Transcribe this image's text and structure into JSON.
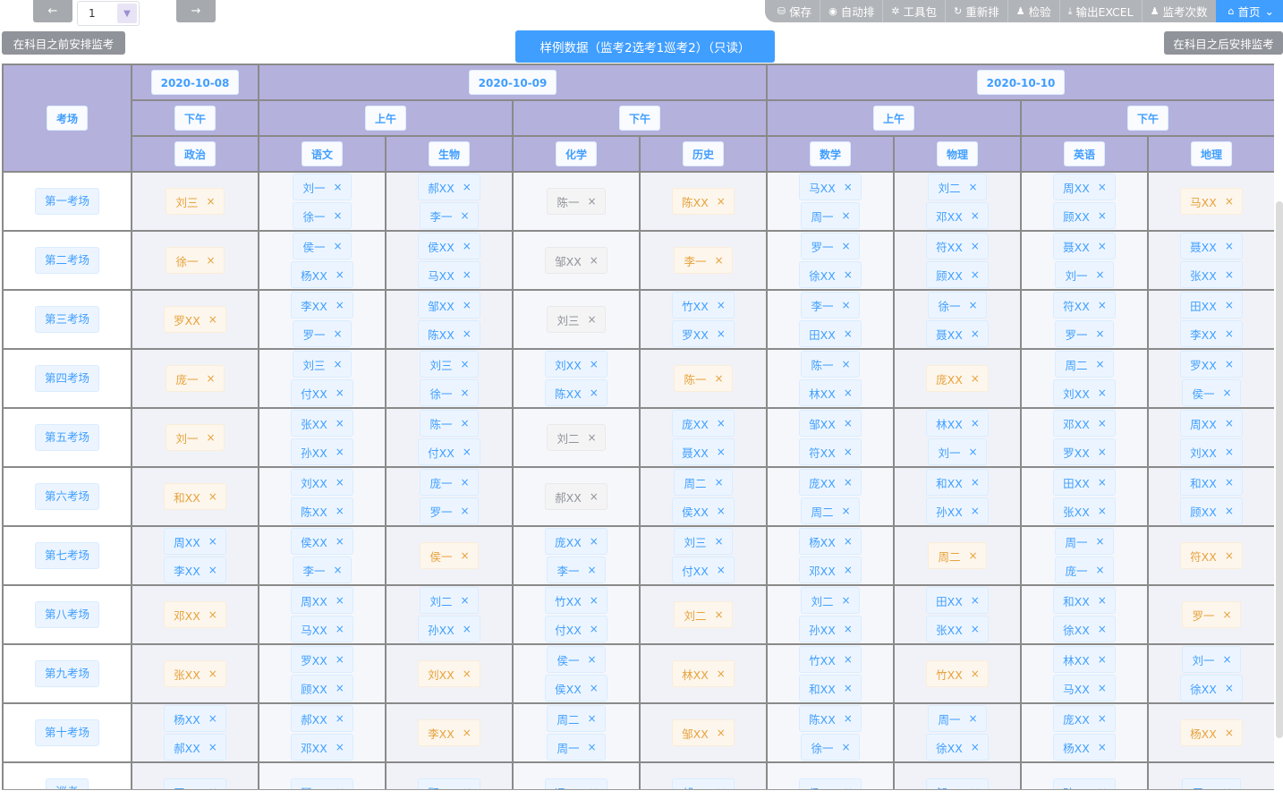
{
  "toolbar": {
    "prev_icon": "←",
    "next_icon": "→",
    "page_value": "1",
    "page_dropdown_icon": "chevron-down",
    "buttons": [
      {
        "icon": "save-icon",
        "glyph": "⛁",
        "label": "保存"
      },
      {
        "icon": "play-circle-icon",
        "glyph": "◉",
        "label": "自动排"
      },
      {
        "icon": "gear-icon",
        "glyph": "✲",
        "label": "工具包"
      },
      {
        "icon": "refresh-icon",
        "glyph": "↻",
        "label": "重新排"
      },
      {
        "icon": "user-icon",
        "glyph": "♟",
        "label": "检验"
      },
      {
        "icon": "download-icon",
        "glyph": "⤓",
        "label": "输出EXCEL"
      },
      {
        "icon": "user-icon",
        "glyph": "♟",
        "label": "监考次数"
      }
    ],
    "home": {
      "icon": "home-icon",
      "glyph": "⌂",
      "label": "首页",
      "caret": "⌄"
    }
  },
  "actions": {
    "before": "在科目之前安排监考",
    "after": "在科目之后安排监考",
    "banner": "样例数据（监考2选考1巡考2）（只读）"
  },
  "header": {
    "room_label": "考场",
    "dates": [
      "2020-10-08",
      "2020-10-09",
      "2020-10-10"
    ],
    "sessions": [
      "下午",
      "上午",
      "下午",
      "上午",
      "下午"
    ],
    "subjects": [
      "政治",
      "语文",
      "生物",
      "化学",
      "历史",
      "数学",
      "物理",
      "英语",
      "地理"
    ]
  },
  "colors": {
    "blue": "#409eff",
    "orange": "#e6a23c",
    "gray": "#909399",
    "header_bg": "#b4b1dd"
  },
  "remove_icon": "×",
  "rows": [
    {
      "room": "第一考场",
      "cells": [
        {
          "c": "orange",
          "n": [
            "刘三"
          ]
        },
        {
          "c": "blue",
          "n": [
            "刘一",
            "徐一"
          ]
        },
        {
          "c": "blue",
          "n": [
            "郝XX",
            "李一"
          ]
        },
        {
          "c": "gray",
          "n": [
            "陈一"
          ]
        },
        {
          "c": "orange",
          "n": [
            "陈XX"
          ]
        },
        {
          "c": "blue",
          "n": [
            "马XX",
            "周一"
          ]
        },
        {
          "c": "blue",
          "n": [
            "刘二",
            "邓XX"
          ]
        },
        {
          "c": "blue",
          "n": [
            "周XX",
            "顾XX"
          ]
        },
        {
          "c": "orange",
          "n": [
            "马XX"
          ]
        }
      ]
    },
    {
      "room": "第二考场",
      "cells": [
        {
          "c": "orange",
          "n": [
            "徐一"
          ]
        },
        {
          "c": "blue",
          "n": [
            "侯一",
            "杨XX"
          ]
        },
        {
          "c": "blue",
          "n": [
            "侯XX",
            "马XX"
          ]
        },
        {
          "c": "gray",
          "n": [
            "邹XX"
          ]
        },
        {
          "c": "orange",
          "n": [
            "李一"
          ]
        },
        {
          "c": "blue",
          "n": [
            "罗一",
            "徐XX"
          ]
        },
        {
          "c": "blue",
          "n": [
            "符XX",
            "顾XX"
          ]
        },
        {
          "c": "blue",
          "n": [
            "聂XX",
            "刘一"
          ]
        },
        {
          "c": "blue",
          "n": [
            "聂XX",
            "张XX"
          ]
        }
      ]
    },
    {
      "room": "第三考场",
      "cells": [
        {
          "c": "orange",
          "n": [
            "罗XX"
          ]
        },
        {
          "c": "blue",
          "n": [
            "李XX",
            "罗一"
          ]
        },
        {
          "c": "blue",
          "n": [
            "邹XX",
            "陈XX"
          ]
        },
        {
          "c": "gray",
          "n": [
            "刘三"
          ]
        },
        {
          "c": "blue",
          "n": [
            "竹XX",
            "罗XX"
          ]
        },
        {
          "c": "blue",
          "n": [
            "李一",
            "田XX"
          ]
        },
        {
          "c": "blue",
          "n": [
            "徐一",
            "聂XX"
          ]
        },
        {
          "c": "blue",
          "n": [
            "符XX",
            "罗一"
          ]
        },
        {
          "c": "blue",
          "n": [
            "田XX",
            "李XX"
          ]
        }
      ]
    },
    {
      "room": "第四考场",
      "cells": [
        {
          "c": "orange",
          "n": [
            "庞一"
          ]
        },
        {
          "c": "blue",
          "n": [
            "刘三",
            "付XX"
          ]
        },
        {
          "c": "blue",
          "n": [
            "刘三",
            "徐一"
          ]
        },
        {
          "c": "blue",
          "n": [
            "刘XX",
            "陈XX"
          ]
        },
        {
          "c": "orange",
          "n": [
            "陈一"
          ]
        },
        {
          "c": "blue",
          "n": [
            "陈一",
            "林XX"
          ]
        },
        {
          "c": "orange",
          "n": [
            "庞XX"
          ]
        },
        {
          "c": "blue",
          "n": [
            "周二",
            "刘XX"
          ]
        },
        {
          "c": "blue",
          "n": [
            "罗XX",
            "侯一"
          ]
        }
      ]
    },
    {
      "room": "第五考场",
      "cells": [
        {
          "c": "orange",
          "n": [
            "刘一"
          ]
        },
        {
          "c": "blue",
          "n": [
            "张XX",
            "孙XX"
          ]
        },
        {
          "c": "blue",
          "n": [
            "陈一",
            "付XX"
          ]
        },
        {
          "c": "gray",
          "n": [
            "刘二"
          ]
        },
        {
          "c": "blue",
          "n": [
            "庞XX",
            "聂XX"
          ]
        },
        {
          "c": "blue",
          "n": [
            "邹XX",
            "符XX"
          ]
        },
        {
          "c": "blue",
          "n": [
            "林XX",
            "刘一"
          ]
        },
        {
          "c": "blue",
          "n": [
            "邓XX",
            "罗XX"
          ]
        },
        {
          "c": "blue",
          "n": [
            "周XX",
            "刘XX"
          ]
        }
      ]
    },
    {
      "room": "第六考场",
      "cells": [
        {
          "c": "orange",
          "n": [
            "和XX"
          ]
        },
        {
          "c": "blue",
          "n": [
            "刘XX",
            "陈XX"
          ]
        },
        {
          "c": "blue",
          "n": [
            "庞一",
            "罗一"
          ]
        },
        {
          "c": "gray",
          "n": [
            "郝XX"
          ]
        },
        {
          "c": "blue",
          "n": [
            "周二",
            "侯XX"
          ]
        },
        {
          "c": "blue",
          "n": [
            "庞XX",
            "周二"
          ]
        },
        {
          "c": "blue",
          "n": [
            "和XX",
            "孙XX"
          ]
        },
        {
          "c": "blue",
          "n": [
            "田XX",
            "张XX"
          ]
        },
        {
          "c": "blue",
          "n": [
            "和XX",
            "顾XX"
          ]
        }
      ]
    },
    {
      "room": "第七考场",
      "cells": [
        {
          "c": "blue",
          "n": [
            "周XX",
            "李XX"
          ]
        },
        {
          "c": "blue",
          "n": [
            "侯XX",
            "李一"
          ]
        },
        {
          "c": "orange",
          "n": [
            "侯一"
          ]
        },
        {
          "c": "blue",
          "n": [
            "庞XX",
            "李一"
          ]
        },
        {
          "c": "blue",
          "n": [
            "刘三",
            "付XX"
          ]
        },
        {
          "c": "blue",
          "n": [
            "杨XX",
            "邓XX"
          ]
        },
        {
          "c": "orange",
          "n": [
            "周二"
          ]
        },
        {
          "c": "blue",
          "n": [
            "周一",
            "庞一"
          ]
        },
        {
          "c": "orange",
          "n": [
            "符XX"
          ]
        }
      ]
    },
    {
      "room": "第八考场",
      "cells": [
        {
          "c": "orange",
          "n": [
            "邓XX"
          ]
        },
        {
          "c": "blue",
          "n": [
            "周XX",
            "马XX"
          ]
        },
        {
          "c": "blue",
          "n": [
            "刘二",
            "孙XX"
          ]
        },
        {
          "c": "blue",
          "n": [
            "竹XX",
            "付XX"
          ]
        },
        {
          "c": "orange",
          "n": [
            "刘二"
          ]
        },
        {
          "c": "blue",
          "n": [
            "刘二",
            "孙XX"
          ]
        },
        {
          "c": "blue",
          "n": [
            "田XX",
            "张XX"
          ]
        },
        {
          "c": "blue",
          "n": [
            "和XX",
            "徐XX"
          ]
        },
        {
          "c": "orange",
          "n": [
            "罗一"
          ]
        }
      ]
    },
    {
      "room": "第九考场",
      "cells": [
        {
          "c": "orange",
          "n": [
            "张XX"
          ]
        },
        {
          "c": "blue",
          "n": [
            "罗XX",
            "顾XX"
          ]
        },
        {
          "c": "orange",
          "n": [
            "刘XX"
          ]
        },
        {
          "c": "blue",
          "n": [
            "侯一",
            "侯XX"
          ]
        },
        {
          "c": "orange",
          "n": [
            "林XX"
          ]
        },
        {
          "c": "blue",
          "n": [
            "竹XX",
            "和XX"
          ]
        },
        {
          "c": "orange",
          "n": [
            "竹XX"
          ]
        },
        {
          "c": "blue",
          "n": [
            "林XX",
            "马XX"
          ]
        },
        {
          "c": "blue",
          "n": [
            "刘一",
            "徐XX"
          ]
        }
      ]
    },
    {
      "room": "第十考场",
      "cells": [
        {
          "c": "blue",
          "n": [
            "杨XX",
            "郝XX"
          ]
        },
        {
          "c": "blue",
          "n": [
            "郝XX",
            "邓XX"
          ]
        },
        {
          "c": "orange",
          "n": [
            "李XX"
          ]
        },
        {
          "c": "blue",
          "n": [
            "周二",
            "周一"
          ]
        },
        {
          "c": "orange",
          "n": [
            "邹XX"
          ]
        },
        {
          "c": "blue",
          "n": [
            "陈XX",
            "徐一"
          ]
        },
        {
          "c": "blue",
          "n": [
            "周一",
            "徐XX"
          ]
        },
        {
          "c": "blue",
          "n": [
            "庞XX",
            "杨XX"
          ]
        },
        {
          "c": "orange",
          "n": [
            "杨XX"
          ]
        }
      ]
    },
    {
      "room": "巡考",
      "cells": [
        {
          "c": "blue",
          "n": [
            "田XX"
          ]
        },
        {
          "c": "blue",
          "n": [
            "聂XX"
          ]
        },
        {
          "c": "blue",
          "n": [
            "顾XX"
          ]
        },
        {
          "c": "blue",
          "n": [
            "冯XX"
          ]
        },
        {
          "c": "blue",
          "n": [
            "郝XX"
          ]
        },
        {
          "c": "blue",
          "n": [
            "侯XX"
          ]
        },
        {
          "c": "blue",
          "n": [
            "邹XX"
          ]
        },
        {
          "c": "blue",
          "n": [
            "孙XX"
          ]
        },
        {
          "c": "blue",
          "n": [
            "周一"
          ]
        }
      ]
    }
  ]
}
